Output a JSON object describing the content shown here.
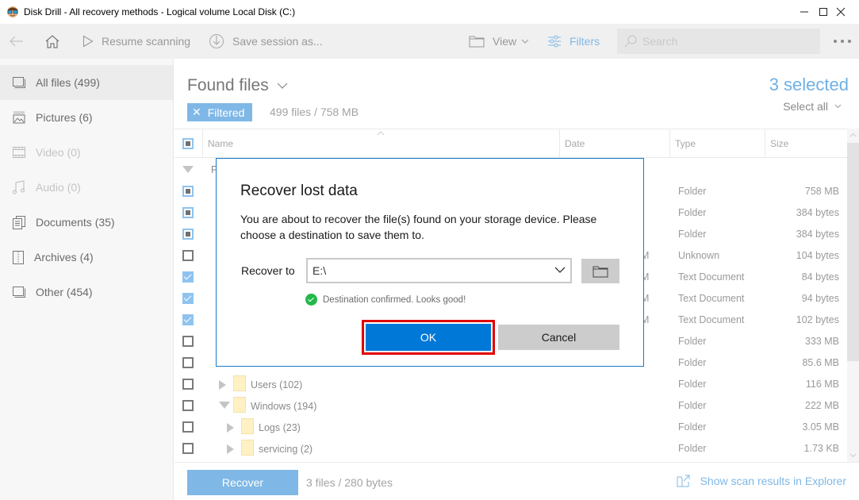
{
  "window": {
    "title": "Disk Drill - All recovery methods - Logical volume Local Disk (C:)",
    "app_icon": "disk-drill-logo-icon",
    "controls": {
      "minimize": "—",
      "maximize": "☐",
      "close": "✕"
    }
  },
  "toolbar": {
    "back_icon": "arrow-left-icon",
    "home_icon": "home-icon",
    "resume_label": "Resume scanning",
    "save_session_label": "Save session as...",
    "view_label": "View",
    "filters_label": "Filters",
    "search_placeholder": "Search",
    "more_icon": "ellipsis-icon"
  },
  "sidebar": {
    "items": [
      {
        "label": "All files (499)",
        "icon": "all-files-icon",
        "state": "active"
      },
      {
        "label": "Pictures (6)",
        "icon": "pictures-icon",
        "state": "normal"
      },
      {
        "label": "Video (0)",
        "icon": "video-icon",
        "state": "disabled"
      },
      {
        "label": "Audio (0)",
        "icon": "audio-icon",
        "state": "disabled"
      },
      {
        "label": "Documents (35)",
        "icon": "documents-icon",
        "state": "normal"
      },
      {
        "label": "Archives (4)",
        "icon": "archives-icon",
        "state": "normal"
      },
      {
        "label": "Other (454)",
        "icon": "other-icon",
        "state": "normal"
      }
    ]
  },
  "main": {
    "title": "Found files",
    "filter_chip": "Filtered",
    "filter_summary": "499 files / 758 MB",
    "selected_count": "3 selected",
    "select_all": "Select all",
    "columns": {
      "name": "Name",
      "date": "Date",
      "type": "Type",
      "size": "Size"
    },
    "rows": [
      {
        "check": "none",
        "name": "F",
        "type": "",
        "size": "",
        "expander": "down",
        "indent": 0,
        "date_fragment": ""
      },
      {
        "check": "partial",
        "name": "",
        "type": "Folder",
        "size": "758 MB",
        "expander": "down",
        "indent": 1,
        "date_fragment": ""
      },
      {
        "check": "partial",
        "name": "",
        "type": "Folder",
        "size": "384 bytes",
        "expander": "",
        "indent": 2,
        "date_fragment": ""
      },
      {
        "check": "partial",
        "name": "",
        "type": "Folder",
        "size": "384 bytes",
        "expander": "",
        "indent": 2,
        "date_fragment": ""
      },
      {
        "check": "empty",
        "name": "",
        "type": "Unknown",
        "size": "104 bytes",
        "expander": "",
        "indent": 2,
        "date_fragment": "M"
      },
      {
        "check": "checked",
        "name": "",
        "type": "Text Document",
        "size": "84 bytes",
        "expander": "",
        "indent": 2,
        "date_fragment": "M"
      },
      {
        "check": "checked",
        "name": "",
        "type": "Text Document",
        "size": "94 bytes",
        "expander": "",
        "indent": 2,
        "date_fragment": "M"
      },
      {
        "check": "checked",
        "name": "",
        "type": "Text Document",
        "size": "102 bytes",
        "expander": "",
        "indent": 2,
        "date_fragment": "M"
      },
      {
        "check": "empty",
        "name": "",
        "type": "Folder",
        "size": "333 MB",
        "expander": "",
        "indent": 1,
        "date_fragment": ""
      },
      {
        "check": "empty",
        "name": "",
        "type": "Folder",
        "size": "85.6 MB",
        "expander": "",
        "indent": 1,
        "date_fragment": ""
      },
      {
        "check": "empty",
        "name": "Users (102)",
        "type": "Folder",
        "size": "116 MB",
        "expander": "right",
        "indent": 1,
        "date_fragment": ""
      },
      {
        "check": "empty",
        "name": "Windows (194)",
        "type": "Folder",
        "size": "222 MB",
        "expander": "down",
        "indent": 1,
        "date_fragment": ""
      },
      {
        "check": "empty",
        "name": "Logs (23)",
        "type": "Folder",
        "size": "3.05 MB",
        "expander": "right",
        "indent": 2,
        "date_fragment": ""
      },
      {
        "check": "empty",
        "name": "servicing (2)",
        "type": "Folder",
        "size": "1.73 KB",
        "expander": "right",
        "indent": 2,
        "date_fragment": ""
      }
    ]
  },
  "footer": {
    "recover_label": "Recover",
    "recover_summary": "3 files / 280 bytes",
    "explorer_link": "Show scan results in Explorer"
  },
  "dialog": {
    "title": "Recover lost data",
    "message": "You are about to recover the file(s) found on your storage device. Please choose a destination to save them to.",
    "recover_to_label": "Recover to",
    "destination_value": "E:\\",
    "confirmation": "Destination confirmed. Looks good!",
    "ok_label": "OK",
    "cancel_label": "Cancel",
    "highlight_color": "#e00000",
    "accent_color": "#0078d7"
  }
}
